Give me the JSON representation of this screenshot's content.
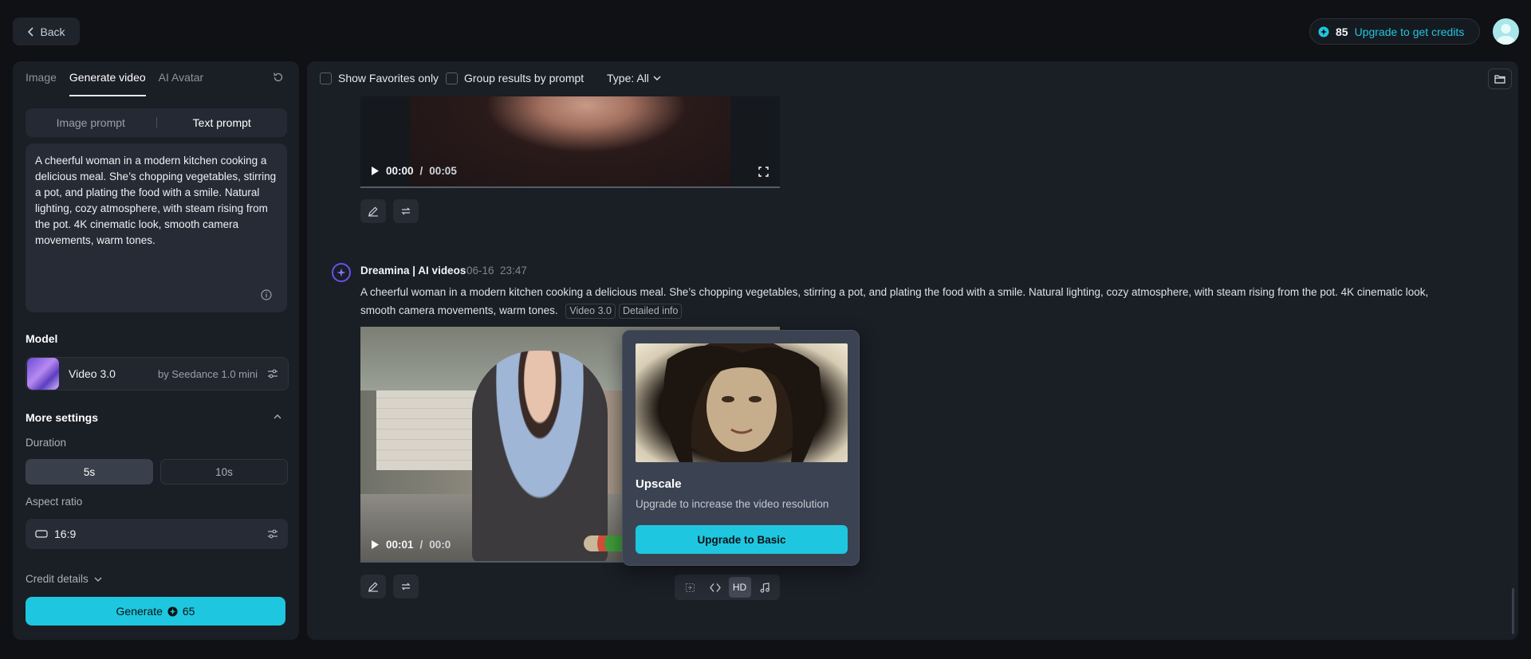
{
  "topbar": {
    "back_label": "Back",
    "credits": "85",
    "upgrade_label": "Upgrade to get credits"
  },
  "left": {
    "tabs": [
      "Image",
      "Generate video",
      "AI Avatar"
    ],
    "active_tab": "Generate video",
    "prompt_modes": [
      "Image prompt",
      "Text prompt"
    ],
    "active_mode": "Text prompt",
    "prompt_text": "A cheerful woman in a modern kitchen cooking a delicious meal. She’s chopping vegetables, stirring a pot, and plating the food with a smile. Natural lighting, cozy atmosphere, with steam rising from the pot. 4K cinematic look, smooth camera movements, warm tones.",
    "model_label": "Model",
    "model_name": "Video 3.0",
    "model_by": "by Seedance 1.0 mini",
    "more_settings_label": "More settings",
    "duration_label": "Duration",
    "duration_options": [
      "5s",
      "10s"
    ],
    "duration_selected": "5s",
    "aspect_label": "Aspect ratio",
    "aspect_value": "16:9",
    "credit_details_label": "Credit details",
    "generate_label": "Generate",
    "generate_cost": "65"
  },
  "main": {
    "filters": {
      "favorites": "Show Favorites only",
      "group": "Group results by prompt",
      "type": "Type: All"
    },
    "video1": {
      "time": "00:00",
      "duration": "00:05"
    },
    "post": {
      "author": "Dreamina | AI videos",
      "date": "06-16",
      "time": "23:47",
      "prompt": "A cheerful woman in a modern kitchen cooking a delicious meal. She’s chopping vegetables, stirring a pot, and plating the food with a smile. Natural lighting, cozy atmosphere, with steam rising from the pot. 4K cinematic look, smooth camera movements, warm tones.",
      "chips": [
        "Video 3.0",
        "Detailed info"
      ]
    },
    "video2": {
      "time": "00:01",
      "duration_partial": "00:0"
    },
    "popup": {
      "title": "Upscale",
      "description": "Upgrade to increase the video resolution",
      "button": "Upgrade to Basic"
    },
    "tools": {
      "hd_label": "HD"
    }
  },
  "colors": {
    "accent": "#1ec7df",
    "background": "#0f1115",
    "panel": "#1a1e25"
  },
  "icons": [
    "chevron-left-icon",
    "credit-coin-icon",
    "reset-icon",
    "info-icon",
    "sliders-icon",
    "chevron-up-icon",
    "chevron-down-icon",
    "play-icon",
    "fullscreen-icon",
    "pencil-icon",
    "loop-icon",
    "folder-icon",
    "sparkle-icon",
    "music-icon"
  ]
}
